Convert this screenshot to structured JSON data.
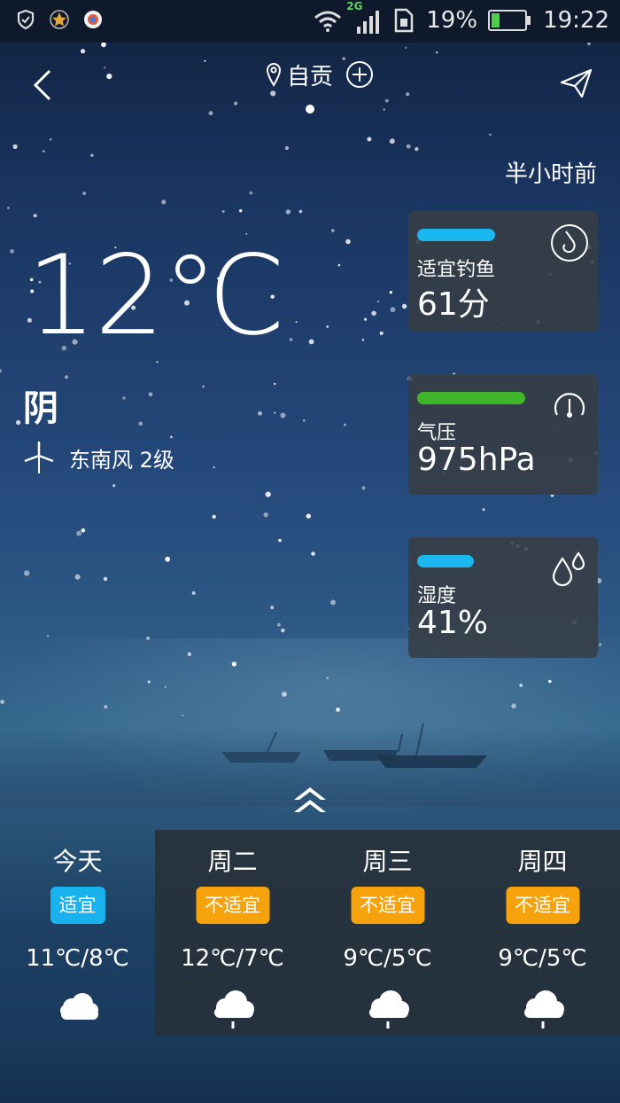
{
  "status_bar": {
    "network": "2G",
    "battery": "19%",
    "time": "19:22",
    "icons": [
      "shield-icon",
      "star-icon",
      "app-badge-icon",
      "wifi-icon",
      "signal-icon",
      "sim-icon",
      "battery-icon"
    ]
  },
  "header": {
    "city": "自贡",
    "updated": "半小时前",
    "icons": [
      "back-icon",
      "location-pin-icon",
      "add-city-icon",
      "share-icon"
    ]
  },
  "current": {
    "temperature": "12℃",
    "condition": "阴",
    "wind": "东南风 2级"
  },
  "cards": [
    {
      "label": "适宜钓鱼",
      "value": "61分",
      "bar_color": "#1ab7f0",
      "bar_fraction": 0.61,
      "icon": "fishing-hook-icon"
    },
    {
      "label": "气压",
      "value": "975hPa",
      "bar_color": "#3fb52a",
      "bar_fraction": 0.85,
      "icon": "gauge-icon"
    },
    {
      "label": "湿度",
      "value": "41%",
      "bar_color": "#1ab7f0",
      "bar_fraction": 0.41,
      "icon": "water-drop-icon"
    }
  ],
  "forecast": [
    {
      "day": "今天",
      "badge": "适宜",
      "badge_color": "#19b2ee",
      "range": "11℃/8℃",
      "icon": "cloudy-icon"
    },
    {
      "day": "周二",
      "badge": "不适宜",
      "badge_color": "#f5a20c",
      "range": "12℃/7℃",
      "icon": "rain-icon"
    },
    {
      "day": "周三",
      "badge": "不适宜",
      "badge_color": "#f5a20c",
      "range": "9℃/5℃",
      "icon": "rain-icon"
    },
    {
      "day": "周四",
      "badge": "不适宜",
      "badge_color": "#f5a20c",
      "range": "9℃/5℃",
      "icon": "rain-icon"
    }
  ]
}
